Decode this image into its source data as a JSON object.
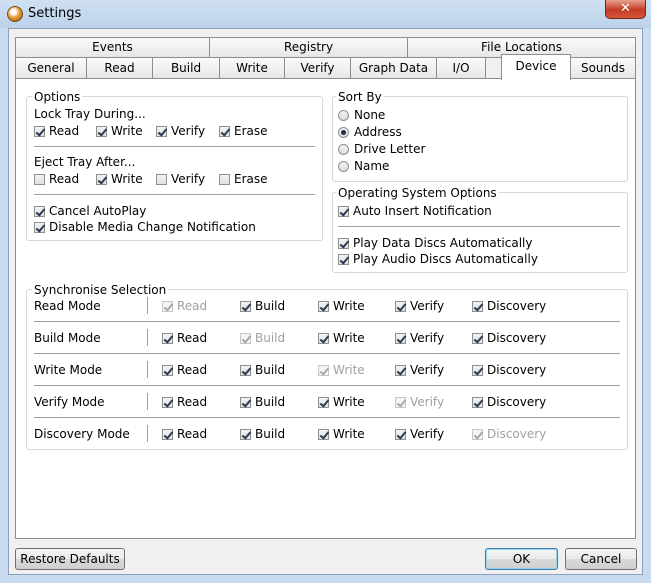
{
  "window": {
    "title": "Settings",
    "close_glyph": "✕"
  },
  "tabs_row1": [
    "Events",
    "Registry",
    "File Locations"
  ],
  "tabs_row2": [
    "General",
    "Read",
    "Build",
    "Write",
    "Verify",
    "Graph Data",
    "I/O",
    "Device",
    "Sounds"
  ],
  "active_tab": "Device",
  "options": {
    "title": "Options",
    "lock_label": "Lock Tray During...",
    "lock": [
      {
        "label": "Read",
        "checked": true
      },
      {
        "label": "Write",
        "checked": true
      },
      {
        "label": "Verify",
        "checked": true
      },
      {
        "label": "Erase",
        "checked": true
      }
    ],
    "eject_label": "Eject Tray After...",
    "eject": [
      {
        "label": "Read",
        "checked": false
      },
      {
        "label": "Write",
        "checked": true
      },
      {
        "label": "Verify",
        "checked": false
      },
      {
        "label": "Erase",
        "checked": false
      }
    ],
    "cancel_autoplay": "Cancel AutoPlay",
    "disable_media_change": "Disable Media Change Notification"
  },
  "sort_by": {
    "title": "Sort By",
    "options": [
      "None",
      "Address",
      "Drive Letter",
      "Name"
    ],
    "selected": "Address"
  },
  "os_options": {
    "title": "Operating System Options",
    "auto_insert": "Auto Insert Notification",
    "play_data": "Play Data Discs Automatically",
    "play_audio": "Play Audio Discs Automatically"
  },
  "sync": {
    "title": "Synchronise Selection",
    "columns": [
      "Read",
      "Build",
      "Write",
      "Verify",
      "Discovery"
    ],
    "rows": [
      {
        "label": "Read Mode",
        "disabled_col": 0
      },
      {
        "label": "Build Mode",
        "disabled_col": 1
      },
      {
        "label": "Write Mode",
        "disabled_col": 2
      },
      {
        "label": "Verify Mode",
        "disabled_col": 3
      },
      {
        "label": "Discovery Mode",
        "disabled_col": 4
      }
    ]
  },
  "buttons": {
    "restore": "Restore Defaults",
    "ok": "OK",
    "cancel": "Cancel"
  }
}
